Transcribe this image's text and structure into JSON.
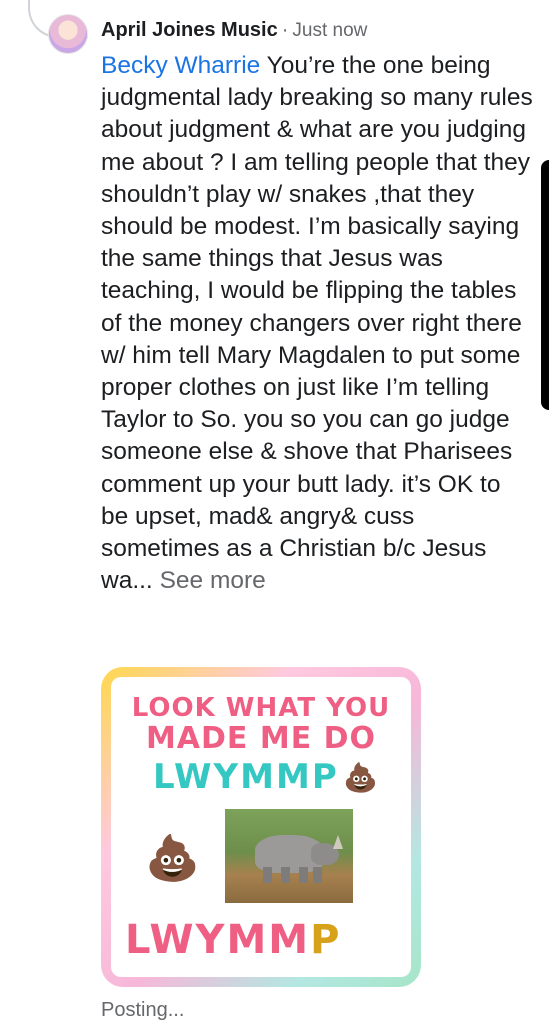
{
  "comment": {
    "author": "April Joines Music",
    "separator": "·",
    "timestamp": "Just now",
    "mention": "Becky Wharrie",
    "body": "You’re the one being judgmental lady breaking so many rules about judgment & what are you judging me about ? I am telling people that they shouldn’t play w/ snakes ,that they should be modest. I’m basically saying the same things that Jesus was teaching, I would be flipping the tables of the money changers over right there w/  him tell Mary Magdalen to put some proper clothes on just like I’m telling Taylor to So.  you so you can go judge someone else & shove that Pharisees comment up your butt lady. it’s OK to be upset, mad& angry& cuss sometimes as a Christian b/c Jesus wa...",
    "see_more": "See more",
    "status": "Posting..."
  },
  "sticker": {
    "line1": "LOOK WHAT YOU",
    "line2": "MADE ME DO",
    "line3": "LWYMMP",
    "line4_main": "LWYMM",
    "line4_last": "P",
    "emoji": "💩",
    "image": "rhino-photo",
    "colors": {
      "pink": "#ef5f84",
      "teal": "#35c8c2",
      "gold": "#d7a21a"
    }
  },
  "colors": {
    "mention": "#1b74e4",
    "secondary_text": "#65676b"
  }
}
